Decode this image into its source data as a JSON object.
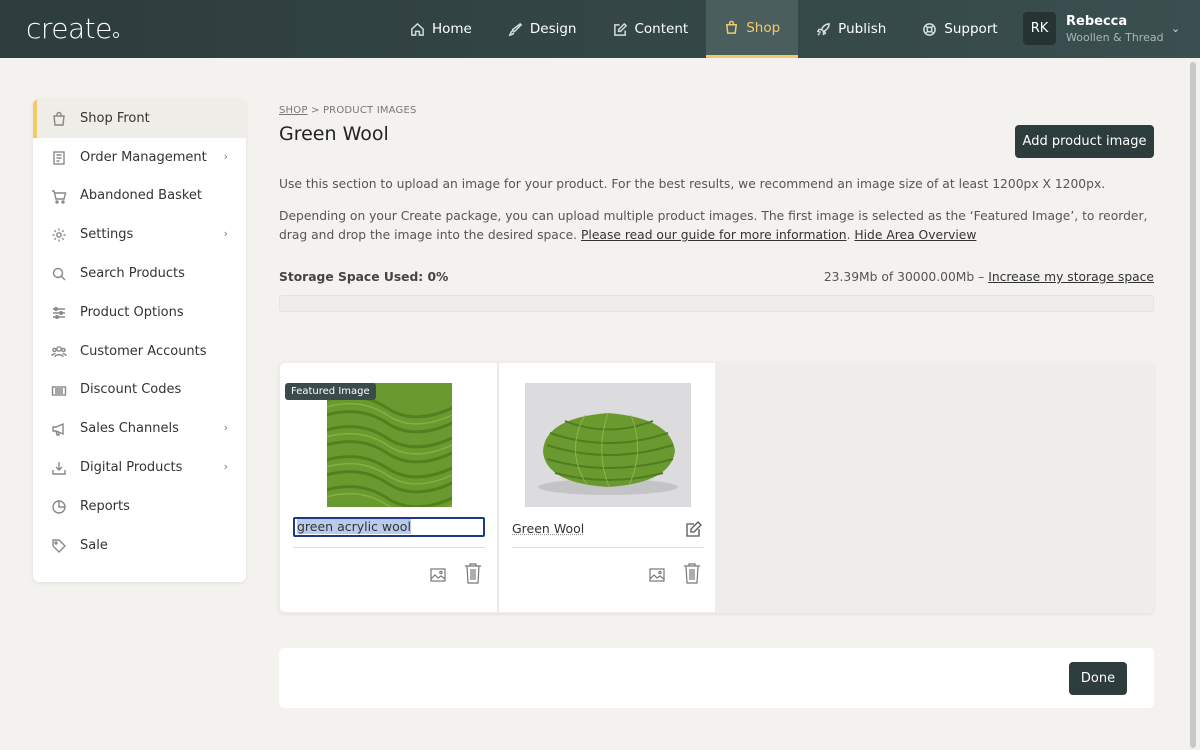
{
  "header": {
    "logo": "create",
    "nav": [
      {
        "label": "Home",
        "icon": "home-icon"
      },
      {
        "label": "Design",
        "icon": "brush-icon"
      },
      {
        "label": "Content",
        "icon": "edit-icon"
      },
      {
        "label": "Shop",
        "icon": "shopping-bag-icon",
        "active": true
      },
      {
        "label": "Publish",
        "icon": "rocket-icon"
      },
      {
        "label": "Support",
        "icon": "lifebuoy-icon"
      }
    ],
    "user": {
      "initials": "RK",
      "name": "Rebecca",
      "subtitle": "Woollen & Thread"
    }
  },
  "sidebar": {
    "items": [
      {
        "label": "Shop Front",
        "icon": "shopping-bag-icon",
        "active": true
      },
      {
        "label": "Order Management",
        "icon": "orders-icon",
        "chevron": true
      },
      {
        "label": "Abandoned Basket",
        "icon": "cart-icon"
      },
      {
        "label": "Settings",
        "icon": "gear-icon",
        "chevron": true
      },
      {
        "label": "Search Products",
        "icon": "search-icon"
      },
      {
        "label": "Product Options",
        "icon": "sliders-icon"
      },
      {
        "label": "Customer Accounts",
        "icon": "users-icon"
      },
      {
        "label": "Discount Codes",
        "icon": "ticket-icon"
      },
      {
        "label": "Sales Channels",
        "icon": "megaphone-icon",
        "chevron": true
      },
      {
        "label": "Digital Products",
        "icon": "download-icon",
        "chevron": true
      },
      {
        "label": "Reports",
        "icon": "pie-chart-icon"
      },
      {
        "label": "Sale",
        "icon": "tag-icon"
      }
    ]
  },
  "main": {
    "breadcrumb": {
      "shop": "SHOP",
      "separator": ">",
      "current": "PRODUCT IMAGES"
    },
    "title": "Green Wool",
    "add_button": "Add product image",
    "description1": "Use this section to upload an image for your product. For the best results, we recommend an image size of at least 1200px X 1200px.",
    "description2": "Depending on your Create package, you can upload multiple product images. The first image is selected as the ‘Featured Image’, to reorder, drag and drop the image into the desired space.",
    "guide_link": "Please read our guide for more information",
    "hide_link": "Hide Area Overview",
    "storage": {
      "label": "Storage Space Used: 0%",
      "used_text": "23.39Mb of 30000.00Mb –",
      "increase_link": "Increase my storage space",
      "percent": 0
    },
    "images": [
      {
        "badge": "Featured Image",
        "alt_text": "green acrylic wool",
        "editing": true
      },
      {
        "alt_text": "Green Wool",
        "editing": false
      }
    ],
    "done_button": "Done"
  },
  "colors": {
    "header_bg": "#2d3c3c",
    "accent": "#f3c969",
    "button_bg": "#2d3c3c",
    "page_bg": "#f4f2ee",
    "yarn_green": "#6a9a2f"
  }
}
